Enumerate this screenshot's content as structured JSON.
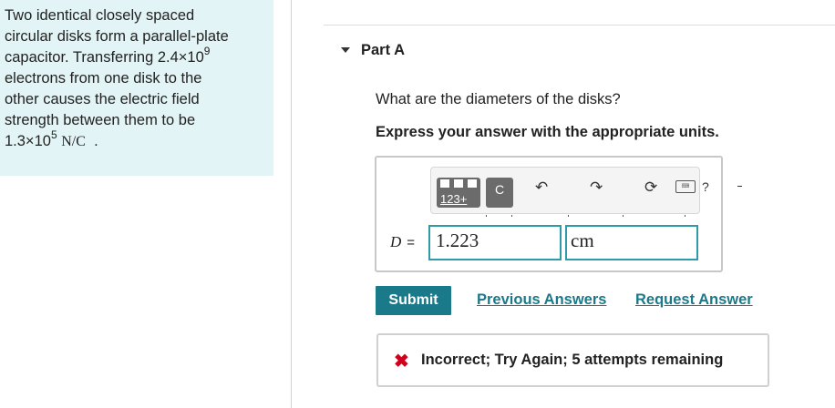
{
  "problem": {
    "line1": "Two identical closely spaced",
    "line2": "circular disks form a parallel-plate",
    "line3_pre": "capacitor. Transferring 2.4×10",
    "line3_exp": "9",
    "line4": "electrons from one disk to the",
    "line5": "other causes the electric field",
    "line6": "strength between them to be",
    "line7_pre": "1.3×10",
    "line7_exp": "5",
    "line7_unit": "N/C",
    "line7_end": "."
  },
  "part": {
    "label": "Part A",
    "icon": "caret-down-icon"
  },
  "question": "What are the diameters of the disks?",
  "instruction": "Express your answer with the appropriate units.",
  "toolbar": {
    "templates_label": "123+",
    "vector_label": "C",
    "icons": [
      "templates-icon",
      "vector-icon",
      "undo-icon",
      "redo-icon",
      "reset-icon",
      "keyboard-icon",
      "help-icon"
    ],
    "help_label": "?"
  },
  "answer": {
    "variable": "D",
    "equals": "=",
    "value": "1.223",
    "unit": "cm"
  },
  "actions": {
    "submit": "Submit",
    "previous_answers": "Previous Answers",
    "request_answer": "Request Answer"
  },
  "feedback": {
    "icon": "x-icon",
    "message": "Incorrect; Try Again; 5 attempts remaining"
  },
  "colors": {
    "accent": "#1b7a8a",
    "problem_bg": "#e3f4f6",
    "input_border": "#2e9ca8",
    "error": "#d0021b"
  }
}
